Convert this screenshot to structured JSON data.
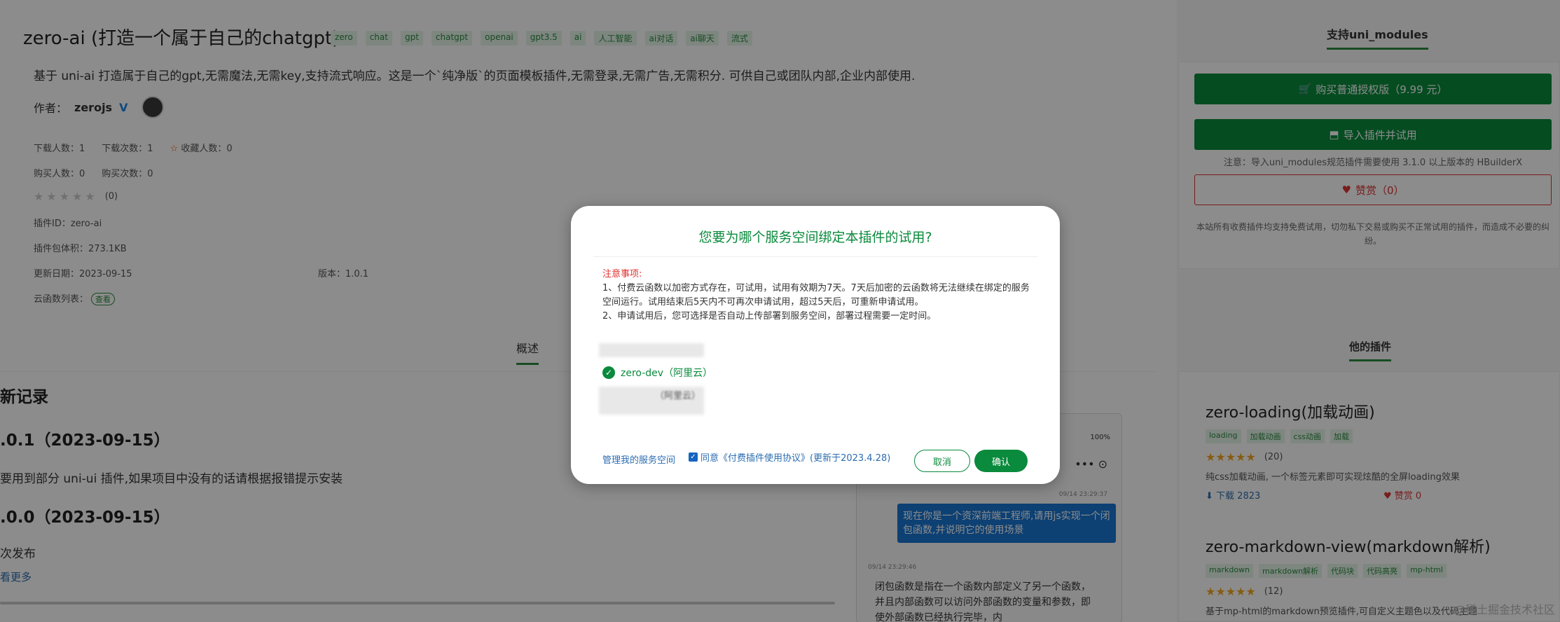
{
  "header": {
    "title": "zero-ai (打造一个属于自己的chatgpt)",
    "tags": [
      "zero",
      "chat",
      "gpt",
      "chatgpt",
      "openai",
      "gpt3.5",
      "ai",
      "人工智能",
      "ai对话",
      "ai聊天",
      "流式"
    ],
    "description": "基于 uni-ai 打造属于自己的gpt,无需魔法,无需key,支持流式响应。这是一个`纯净版`的页面模板插件,无需登录,无需广告,无需积分. 可供自己或团队内部,企业内部使用.",
    "author_label": "作者：",
    "author_name": "zerojs",
    "author_badge": "V"
  },
  "stats": {
    "downloads": "下载人数：1",
    "download_count": "下载次数：1",
    "favorites": "收藏人数：0",
    "buyers": "购买人数：0",
    "purchases": "购买次数：0",
    "rating_count": "(0)",
    "rating_value": 0,
    "plugin_id": "插件ID：zero-ai",
    "package_size": "插件包体积：273.1KB",
    "updated": "更新日期：2023-09-15",
    "version": "版本：1.0.1",
    "cloud_functions": "云函数列表：",
    "view_label": "查看"
  },
  "tabs": {
    "overview": "概述"
  },
  "changelog": {
    "title": "新记录",
    "v1_heading": ".0.1（2023-09-15）",
    "v1_text": "要用到部分 uni-ui 插件,如果项目中没有的话请根据报错提示安装",
    "v0_heading": ".0.0（2023-09-15）",
    "v0_text": "次发布",
    "more": "看更多"
  },
  "phone": {
    "battery": "100%",
    "menu_icons": "•••  ⊙",
    "time1": "09/14 23:29:37",
    "user_msg": "现在你是一个资深前端工程师,请用js实现一个闭包函数,并说明它的使用场景",
    "time2": "09/14 23:29:46",
    "reply": "闭包函数是指在一个函数内部定义了另一个函数，并且内部函数可以访问外部函数的变量和参数，即使外部函数已经执行完毕，内"
  },
  "sidebar": {
    "tab": "支持uni_modules",
    "buy_button": "购买普通授权版（9.99 元）",
    "import_button": "导入插件并试用",
    "import_note": "注意：导入uni_modules规范插件需要使用 3.1.0 以上版本的 HBuilderX",
    "reward_button": "赞赏（0）",
    "notice": "本站所有收费插件均支持免费试用，切勿私下交易或购买不正常试用的插件，而造成不必要的纠纷。",
    "other_title": "他的插件",
    "plugins": [
      {
        "name": "zero-loading(加载动画)",
        "tags": [
          "loading",
          "加载动画",
          "css动画",
          "加载"
        ],
        "rating": "(20)",
        "desc": "纯css加载动画, 一个标签元素即可实现炫酷的全屏loading效果",
        "downloads": "下载 2823",
        "reward": "赞赏 0"
      },
      {
        "name": "zero-markdown-view(markdown解析)",
        "tags": [
          "markdown",
          "markdown解析",
          "代码块",
          "代码高亮",
          "mp-html"
        ],
        "rating": "(12)",
        "desc": "基于mp-html的markdown预览插件,可自定义主题色以及代码主题"
      }
    ],
    "watermark": "@稀土掘金技术社区"
  },
  "modal": {
    "title": "您要为哪个服务空间绑定本插件的试用?",
    "notes_heading": "注意事项:",
    "note1": "1、付费云函数以加密方式存在，可试用，试用有效期为7天。7天后加密的云函数将无法继续在绑定的服务空间运行。试用结束后5天内不可再次申请试用，超过5天后，可重新申请试用。",
    "note2": "2、申请试用后，您可选择是否自动上传部署到服务空间，部署过程需要一定时间。",
    "selected_space": "zero-dev（阿里云）",
    "blurred_option": "（阿里云）",
    "manage_link": "管理我的服务空间",
    "agree_text": "同意《付费插件使用协议》(更新于2023.4.28)",
    "cancel": "取消",
    "confirm": "确认"
  },
  "colors": {
    "brand_green": "#0a8a3c",
    "accent_red": "#d33",
    "link_blue": "#2b6cb0"
  }
}
